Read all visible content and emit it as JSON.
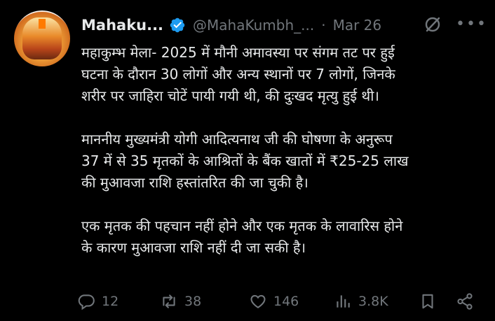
{
  "tweet": {
    "display_name": "Mahaku...",
    "handle": "@MahaKumbh_...",
    "separator": "·",
    "date": "Mar 26",
    "paragraph1": [
      "महाकुम्भ मेला- 2025 में मौनी अमावस्या पर संगम तट पर हुई",
      "घटना के दौरान 30 लोगों और अन्य स्थानों पर 7 लोगों, जिनके",
      "शरीर पर जाहिरा चोटें पायी गयी थी, की दुःखद मृत्यु हुई थी।"
    ],
    "paragraph2": [
      "माननीय मुख्यमंत्री योगी आदित्यनाथ जी की घोषणा के अनुरूप",
      "37 में से 35 मृतकों के आश्रितों के बैंक खातों में ₹25-25 लाख",
      "की मुआवजा राशि हस्तांतरित की जा चुकी है।"
    ],
    "paragraph3": [
      "एक मृतक की पहचान नहीं होने और एक मृतक के लावारिस होने",
      "के कारण मुआवजा राशि नहीं दी जा सकी है।"
    ]
  },
  "actions": {
    "replies": "12",
    "reposts": "38",
    "likes": "146",
    "views": "3.8K"
  },
  "colors": {
    "background": "#000000",
    "text": "#e7e9ea",
    "muted": "#71767b",
    "verified_badge": "#1d9bf0"
  },
  "icons": [
    "verified-badge-icon",
    "grok-icon",
    "more-icon",
    "reply-icon",
    "repost-icon",
    "like-icon",
    "views-icon",
    "bookmark-icon",
    "share-icon"
  ]
}
